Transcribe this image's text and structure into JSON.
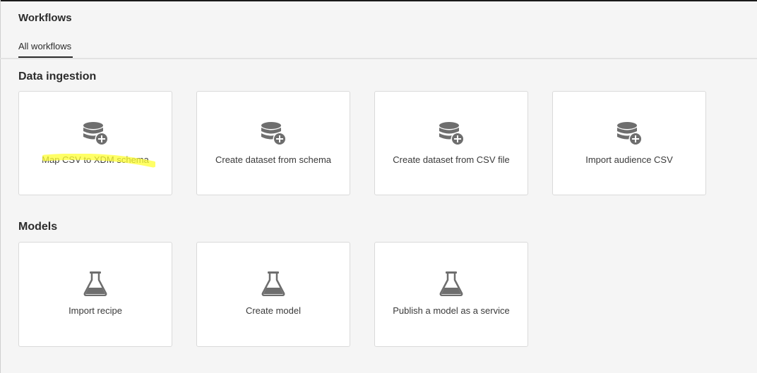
{
  "page": {
    "title": "Workflows"
  },
  "tabs": [
    {
      "label": "All workflows",
      "selected": true
    }
  ],
  "sections": [
    {
      "title": "Data ingestion",
      "cards": [
        {
          "label": "Map CSV to XDM schema",
          "icon": "database-add-icon",
          "highlighted": true
        },
        {
          "label": "Create dataset from schema",
          "icon": "database-add-icon"
        },
        {
          "label": "Create dataset from CSV file",
          "icon": "database-add-icon"
        },
        {
          "label": "Import audience CSV",
          "icon": "database-add-icon"
        }
      ]
    },
    {
      "title": "Models",
      "cards": [
        {
          "label": "Import recipe",
          "icon": "flask-icon"
        },
        {
          "label": "Create model",
          "icon": "flask-icon"
        },
        {
          "label": "Publish a model as a service",
          "icon": "flask-icon"
        }
      ]
    }
  ],
  "colors": {
    "background": "#f5f5f5",
    "card": "#ffffff",
    "icon": "#6e6e6e",
    "highlight": "#ffff33"
  }
}
